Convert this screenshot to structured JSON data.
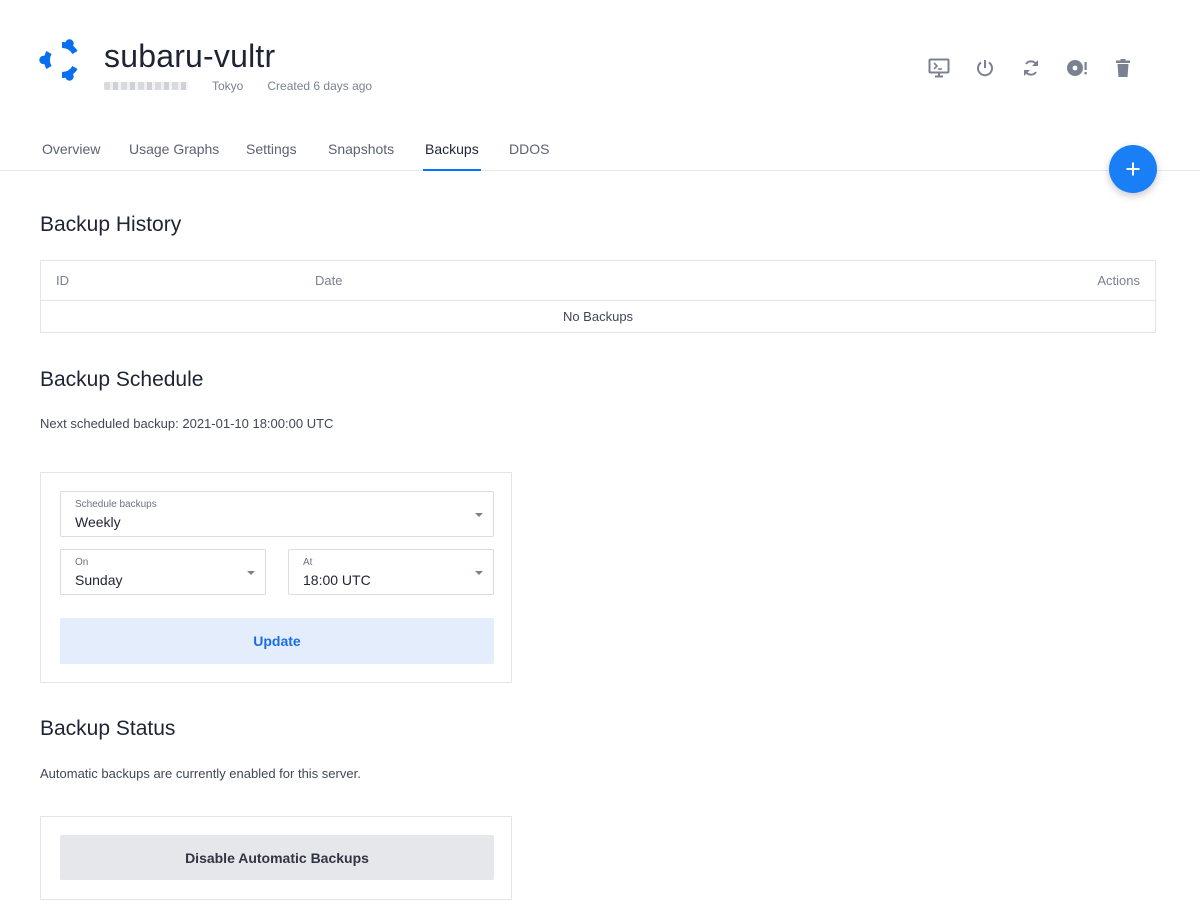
{
  "server": {
    "name": "subaru-vultr",
    "location": "Tokyo",
    "created": "Created 6 days ago",
    "os_icon": "ubuntu-logo"
  },
  "header_actions": [
    {
      "name": "console-icon",
      "icon": "monitor-terminal"
    },
    {
      "name": "power-icon",
      "icon": "power"
    },
    {
      "name": "restart-icon",
      "icon": "refresh"
    },
    {
      "name": "reinstall-icon",
      "icon": "disc-alert"
    },
    {
      "name": "delete-icon",
      "icon": "trash"
    }
  ],
  "tabs": [
    {
      "label": "Overview",
      "active": false
    },
    {
      "label": "Usage Graphs",
      "active": false
    },
    {
      "label": "Settings",
      "active": false
    },
    {
      "label": "Snapshots",
      "active": false
    },
    {
      "label": "Backups",
      "active": true
    },
    {
      "label": "DDOS",
      "active": false
    }
  ],
  "fab": {
    "icon": "plus-icon"
  },
  "backup_history": {
    "title": "Backup History",
    "columns": [
      "ID",
      "Date",
      "Actions"
    ],
    "empty_text": "No Backups"
  },
  "backup_schedule": {
    "title": "Backup Schedule",
    "next_text": "Next scheduled backup: 2021-01-10 18:00:00 UTC",
    "frequency": {
      "label": "Schedule backups",
      "value": "Weekly"
    },
    "day": {
      "label": "On",
      "value": "Sunday"
    },
    "time": {
      "label": "At",
      "value": "18:00 UTC"
    },
    "update_label": "Update"
  },
  "backup_status": {
    "title": "Backup Status",
    "status_text": "Automatic backups are currently enabled for this server.",
    "disable_label": "Disable Automatic Backups"
  },
  "colors": {
    "accent": "#0075ff",
    "logo": "#0a6ef0",
    "icon_gray": "#7a8191"
  }
}
